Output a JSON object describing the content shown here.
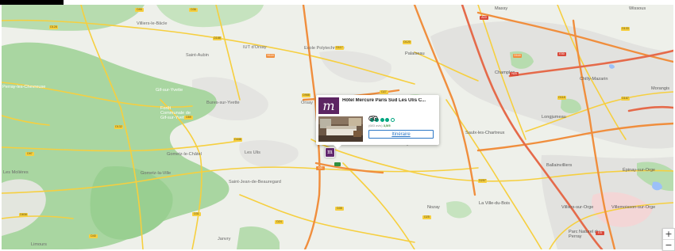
{
  "map": {
    "places": [
      "Villiers-le-Bâcle",
      "Saint-Aubin",
      "IUT d'Orsay",
      "Ecole Polytechnique",
      "Massy",
      "Wissous",
      "Palaiseau",
      "Champlan",
      "Chilly-Mazarin",
      "Morangis",
      "Gif-sur-Yvette",
      "Bures-sur-Yvette",
      "Orsay",
      "Forêt Communale de Gif-sur-Yvette",
      "Longjumeau",
      "Saulx-les-Chartreux",
      "Gometz-le-Châtel",
      "Les Ulis",
      "Villejust",
      "Les Molières",
      "Gometz-la-Ville",
      "Saint-Jean-de-Beauregard",
      "Nozay",
      "La Ville-du-Bois",
      "Ballainvilliers",
      "Épinay-sur-Orge",
      "Villiers-sur-Orge",
      "Villemoisson-sur-Orge",
      "Parc Naturel du Perray",
      "Limours",
      "Janvry",
      "Perray-les-Chevreuse"
    ],
    "road_numbers": [
      "D95",
      "D36",
      "D128",
      "D188",
      "D117",
      "D120",
      "N118",
      "A10",
      "D988",
      "D59",
      "D446",
      "D35",
      "D118",
      "D133",
      "D24",
      "D3",
      "D97",
      "N20",
      "D167",
      "D25",
      "D257",
      "D132",
      "D838",
      "D40",
      "D27",
      "E5",
      "E50",
      "D118",
      "D31"
    ]
  },
  "hotel_card": {
    "logo_letter": "m",
    "name": "Hôtel Mercure Paris Sud Les Ulis C...",
    "rating_bubbles": 5,
    "rating_filled": 4,
    "reviews_text": "(683 avis)",
    "score_text": "3,5/5",
    "itinerary_label": "Itinéraire"
  },
  "marker": {
    "glyph": "m",
    "brand_color": "#61266d"
  },
  "controls": {
    "zoom_in": "+",
    "zoom_out": "−"
  },
  "colors": {
    "land": "#eef0ea",
    "forest": "#a8d5a0",
    "urban": "#e1e1df",
    "motorway": "#f08e3d",
    "main_road": "#f6cf3f"
  }
}
